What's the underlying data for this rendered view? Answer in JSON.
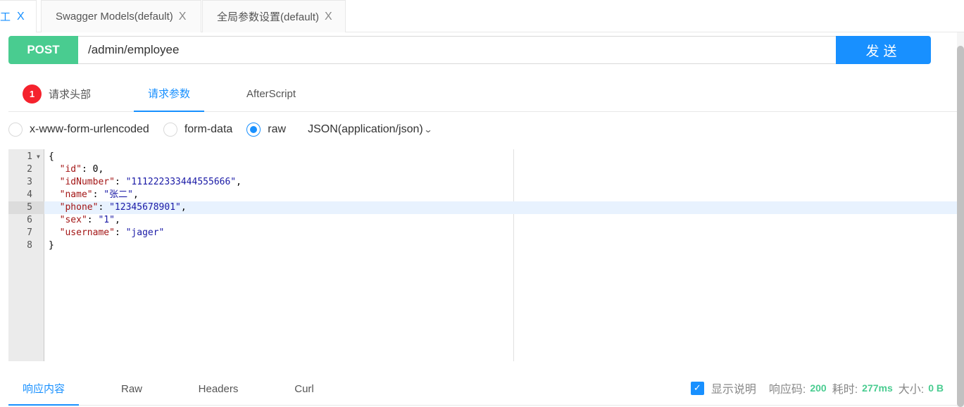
{
  "tabs": [
    {
      "label": "工",
      "close": "X"
    },
    {
      "label": "Swagger Models(default)",
      "close": "X"
    },
    {
      "label": "全局参数设置(default)",
      "close": "X"
    }
  ],
  "request": {
    "method": "POST",
    "url": "/admin/employee",
    "send_label": "发送"
  },
  "subtabs": {
    "headers_badge": "1",
    "headers": "请求头部",
    "params": "请求参数",
    "afterscript": "AfterScript"
  },
  "body_types": {
    "urlencoded": "x-www-form-urlencoded",
    "formdata": "form-data",
    "raw": "raw",
    "selected": "raw",
    "content_type": "JSON(application/json)"
  },
  "editor": {
    "active_line": 5,
    "lines": [
      {
        "no": "1",
        "text": "{"
      },
      {
        "no": "2",
        "key": "\"id\"",
        "sep": ": ",
        "val": "0",
        "end": ","
      },
      {
        "no": "3",
        "key": "\"idNumber\"",
        "sep": ": ",
        "val": "\"111222333444555666\"",
        "end": ","
      },
      {
        "no": "4",
        "key": "\"name\"",
        "sep": ": ",
        "val": "\"张二\"",
        "end": ","
      },
      {
        "no": "5",
        "key": "\"phone\"",
        "sep": ": ",
        "val": "\"12345678901\"",
        "end": ","
      },
      {
        "no": "6",
        "key": "\"sex\"",
        "sep": ": ",
        "val": "\"1\"",
        "end": ","
      },
      {
        "no": "7",
        "key": "\"username\"",
        "sep": ": ",
        "val": "\"jager\"",
        "end": ""
      },
      {
        "no": "8",
        "text": "}"
      }
    ]
  },
  "response": {
    "tabs": [
      "响应内容",
      "Raw",
      "Headers",
      "Curl"
    ],
    "show_desc": "显示说明",
    "code_label": "响应码:",
    "code": "200",
    "time_label": "耗时:",
    "time": "277ms",
    "size_label": "大小:",
    "size": "0 B"
  },
  "colors": {
    "accent": "#1890ff",
    "post": "#49cc90",
    "badge": "#f5222d"
  }
}
